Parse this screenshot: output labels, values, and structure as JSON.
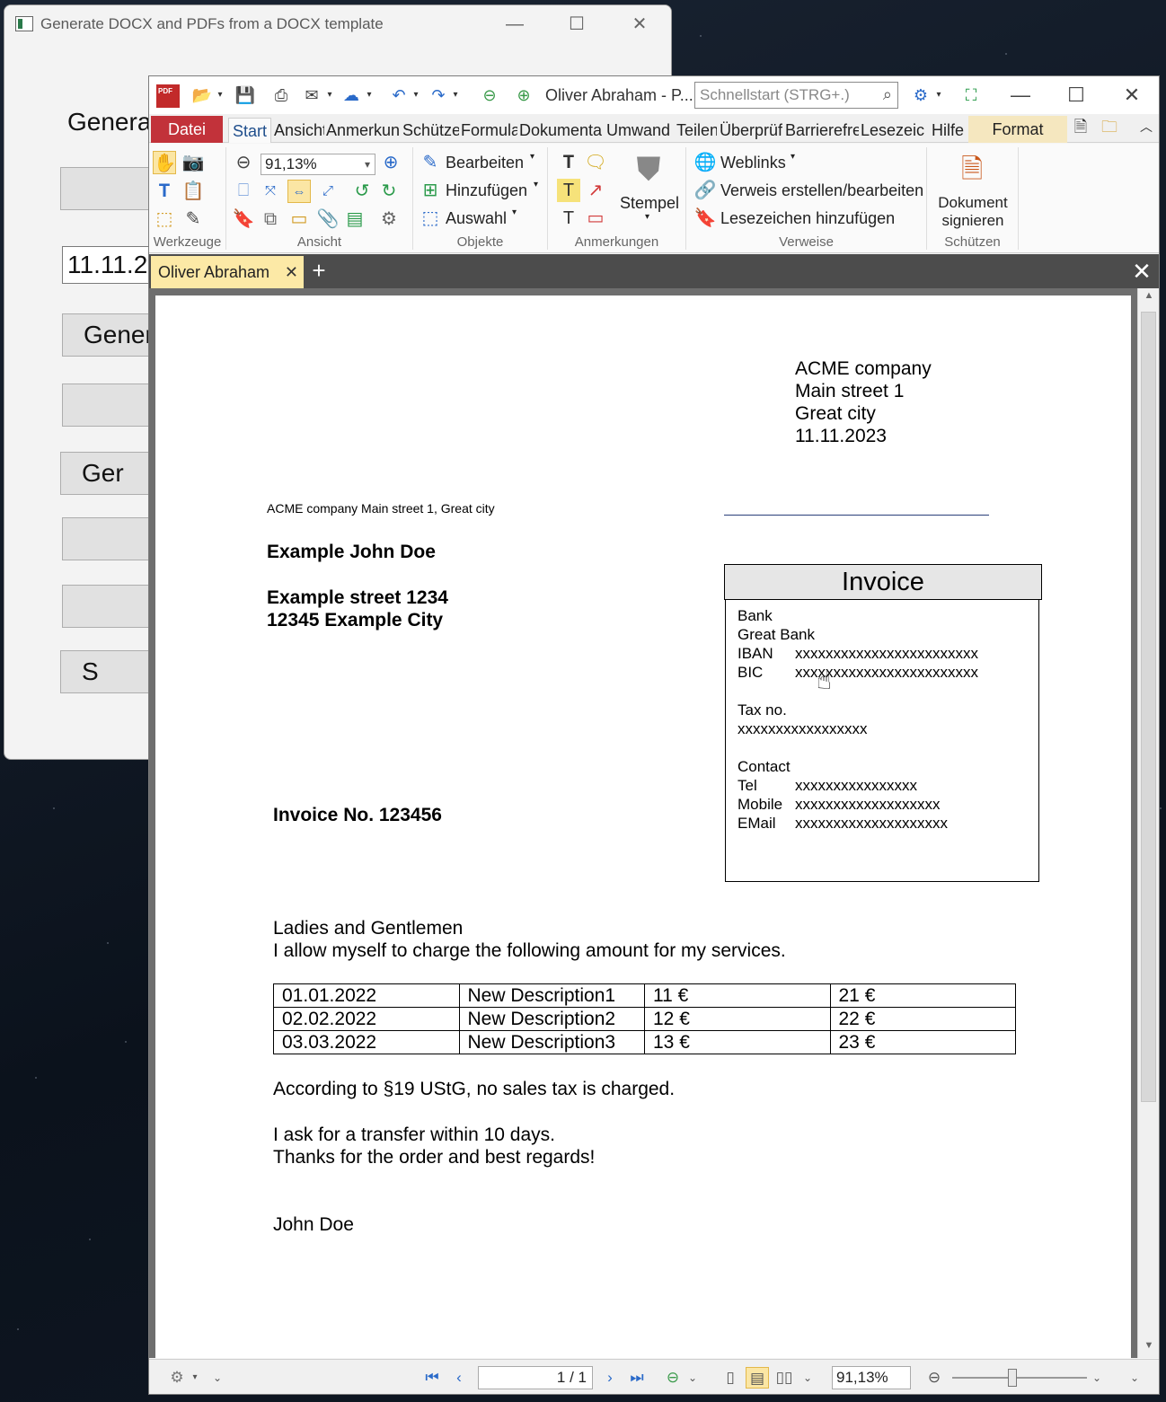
{
  "bg_window": {
    "title": "Generate DOCX and PDFs from a DOCX template",
    "heading": "Genera",
    "date_field_value": "11.11.2",
    "buttons": [
      "",
      "Gener",
      "",
      "Ger",
      "",
      "",
      "S"
    ]
  },
  "pdf_window": {
    "title": "Oliver Abraham - P...",
    "quickstart_placeholder": "Schnellstart (STRG+.)",
    "ribbon_tabs": [
      "Start",
      "Ansicht",
      "Anmerkun",
      "Schütze",
      "Formula",
      "Dokumenta",
      "Umwand",
      "Teilen",
      "Überprüf",
      "Barrierefre",
      "Lesezeich",
      "Hilfe"
    ],
    "file_tab": "Datei",
    "format_tab": "Format",
    "ribbon": {
      "zoom_value": "91,13%",
      "groups": {
        "tools": "Werkzeuge",
        "view": "Ansicht",
        "objects": "Objekte",
        "annotations": "Anmerkungen",
        "links": "Verweise",
        "protect": "Schützen"
      },
      "objects": {
        "edit": "Bearbeiten",
        "add": "Hinzufügen",
        "select": "Auswahl"
      },
      "stamp": "Stempel",
      "links": {
        "weblinks": "Weblinks",
        "link_edit": "Verweis erstellen/bearbeiten",
        "add_bookmark": "Lesezeichen hinzufügen"
      },
      "sign": "Dokument signieren"
    },
    "doc_tab": "Oliver Abraham",
    "status": {
      "page": "1 / 1",
      "zoom": "91,13%"
    },
    "colors": {
      "file_tab": "#c2323a",
      "active_doc_tab": "#fce9a6",
      "accent": "#2a6ac9"
    }
  },
  "document": {
    "sender": [
      "ACME company",
      "Main street 1",
      "Great city",
      "11.11.2023"
    ],
    "return_address": "ACME company Main street 1, Great city",
    "recipient_name": "Example John Doe",
    "recipient_street": "Example street 1234",
    "recipient_city": "12345 Example City",
    "infobox": {
      "title": "Invoice",
      "bank_label": "Bank",
      "bank_name": "Great Bank",
      "iban_label": "IBAN",
      "iban": "xxxxxxxxxxxxxxxxxxxxxxxx",
      "bic_label": "BIC",
      "bic": "xxxxxxxxxxxxxxxxxxxxxxxx",
      "tax_label": "Tax no.",
      "tax": "xxxxxxxxxxxxxxxxx",
      "contact_label": "Contact",
      "tel_label": "Tel",
      "tel": "xxxxxxxxxxxxxxxx",
      "mobile_label": "Mobile",
      "mobile": "xxxxxxxxxxxxxxxxxxx",
      "email_label": "EMail",
      "email": "xxxxxxxxxxxxxxxxxxxx"
    },
    "invoice_no": "Invoice No. 123456",
    "greeting": "Ladies and Gentlemen",
    "intro": "I allow myself to charge the following amount for my services.",
    "items": [
      [
        "01.01.2022",
        "New Description1",
        "11 €",
        "21 €"
      ],
      [
        "02.02.2022",
        "New Description2",
        "12 €",
        "22 €"
      ],
      [
        "03.03.2022",
        "New Description3",
        "13 €",
        "23 €"
      ]
    ],
    "tax_note": "According to §19 UStG, no sales tax is charged.",
    "transfer": "I ask for a transfer within 10 days.",
    "thanks": "Thanks for the order and best regards!",
    "signature": "John Doe"
  }
}
